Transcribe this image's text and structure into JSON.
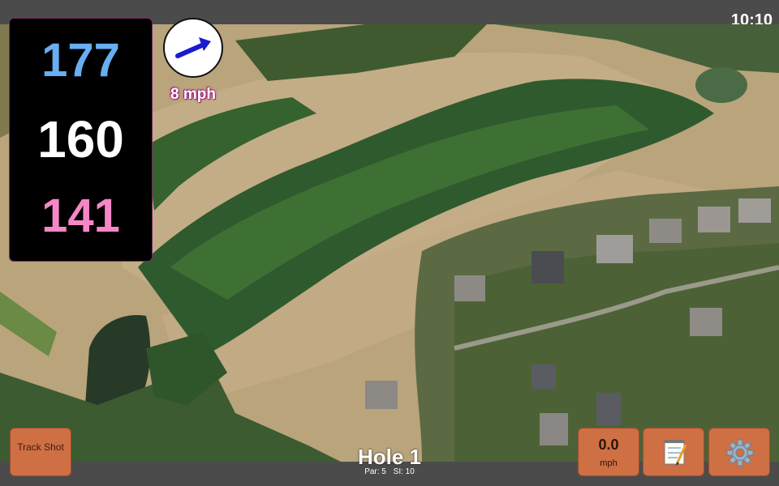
{
  "status_bar": {
    "time": "10:10"
  },
  "distances": {
    "back": "177",
    "middle": "160",
    "front": "141"
  },
  "wind": {
    "speed_label": "8 mph",
    "icon": "wind-direction-arrow-icon"
  },
  "buttons": {
    "track_shot_label": "Track Shot",
    "speed_value": "0.0",
    "speed_unit": "mph",
    "notes_icon": "notepad-icon",
    "settings_icon": "gear-icon"
  },
  "hole": {
    "title": "Hole 1",
    "par": "Par: 5",
    "stroke_index": "SI: 10"
  },
  "colors": {
    "back": "#67aef2",
    "middle": "#ffffff",
    "front": "#f587c7",
    "button": "#cf6f44"
  }
}
